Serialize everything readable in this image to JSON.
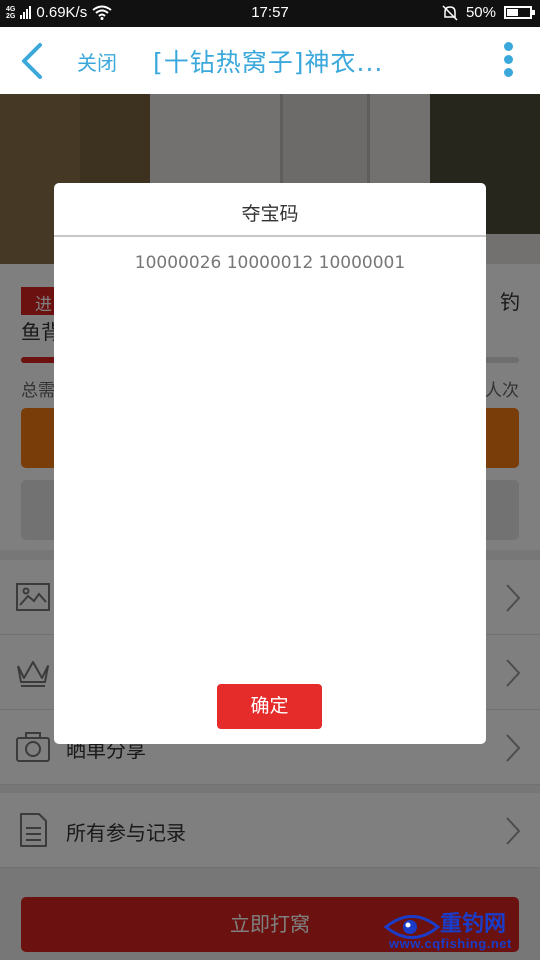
{
  "status_bar": {
    "network": "4G",
    "network_line2": "2G",
    "speed": "0.69K/s",
    "time": "17:57",
    "battery": "50%",
    "battery_level": 0.5
  },
  "header": {
    "back_icon": "chevron-left-icon",
    "close_label": "关闭",
    "title": "[十钻热窝子]神衣...",
    "more_icon": "vertical-dots-icon",
    "accent_color": "#3ba8dc"
  },
  "product": {
    "tag_label": "进",
    "title_right": "钓",
    "subtitle": "鱼背",
    "progress": 0.18,
    "total_left": "总需",
    "total_right": "人次",
    "primary_color": "#d62420",
    "orange_color": "#f27b12"
  },
  "menu": {
    "items": [
      {
        "icon": "image-icon",
        "label": ""
      },
      {
        "icon": "crown-icon",
        "label": ""
      },
      {
        "icon": "camera-icon",
        "label": "晒单分享"
      },
      {
        "icon": "document-icon",
        "label": "所有参与记录"
      }
    ]
  },
  "cta_label": "立即打窝",
  "dialog": {
    "title": "夺宝码",
    "codes": "10000026 10000012 10000001",
    "confirm_label": "确定"
  },
  "watermark": {
    "brand": "重钓网",
    "url": "www.cqfishing.net"
  }
}
